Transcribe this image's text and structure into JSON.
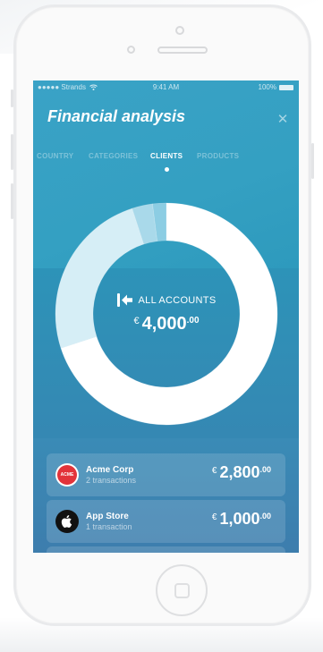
{
  "status_bar": {
    "carrier": "●●●●● Strands",
    "wifi_icon": "wifi-icon",
    "time": "9:41 AM",
    "battery": "100%"
  },
  "header": {
    "title": "Financial analysis",
    "close_icon": "close-icon"
  },
  "tabs": [
    {
      "label": "COUNTRY",
      "active": false
    },
    {
      "label": "CATEGORIES",
      "active": false
    },
    {
      "label": "CLIENTS",
      "active": true
    },
    {
      "label": "PRODUCTS",
      "active": false
    }
  ],
  "summary": {
    "icon": "back-arrow-icon",
    "label": "ALL ACCOUNTS",
    "currency": "€",
    "amount_int": "4,000",
    "amount_dec": ".00"
  },
  "chart_data": {
    "type": "pie",
    "style": "donut",
    "total": 4000,
    "slices": [
      {
        "label": "Acme Corp",
        "value": 2800,
        "color": "#ffffff"
      },
      {
        "label": "App Store",
        "value": 1000,
        "color": "#d6eef6"
      },
      {
        "label": "",
        "value": 120,
        "color": "#a9d9ea"
      },
      {
        "label": "",
        "value": 80,
        "color": "#8ccde3"
      }
    ]
  },
  "clients": [
    {
      "name": "Acme Corp",
      "transactions": "2 transactions",
      "currency": "€",
      "amount_int": "2,800",
      "amount_dec": ".00",
      "logo_text": "ACME",
      "logo_color": "#e2333a"
    },
    {
      "name": "App Store",
      "transactions": "1 transaction",
      "currency": "€",
      "amount_int": "1,000",
      "amount_dec": ".00",
      "logo_icon": "apple-icon"
    }
  ]
}
